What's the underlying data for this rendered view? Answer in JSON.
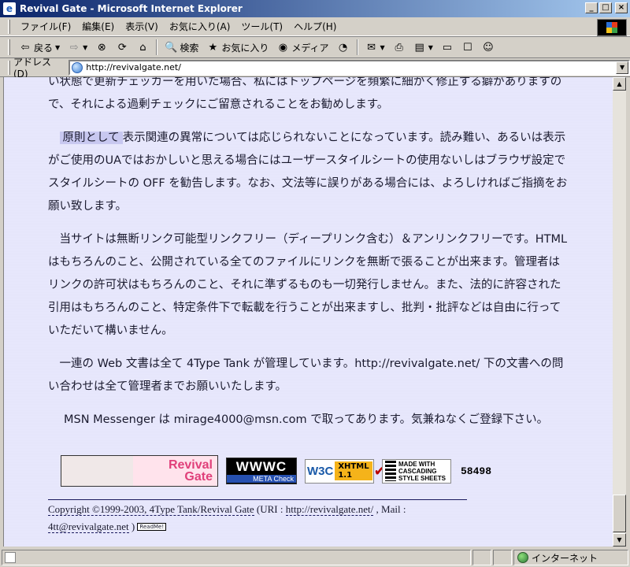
{
  "window": {
    "title": "Revival Gate - Microsoft Internet Explorer",
    "icon": "ie-icon"
  },
  "menu": [
    "ファイル(F)",
    "編集(E)",
    "表示(V)",
    "お気に入り(A)",
    "ツール(T)",
    "ヘルプ(H)"
  ],
  "toolbar": {
    "back": "戻る",
    "search": "検索",
    "favorites": "お気に入り",
    "media": "メディア"
  },
  "address": {
    "label": "アドレス(D)",
    "url": "http://revivalgate.net/"
  },
  "content": {
    "para0": "い状態で更新チェッカーを用いた場合、私にはトップページを頻繁に細かく修正する癖がありますので、それによる過剰チェックにご留意されることをお勧めします。",
    "para1_highlight": "原則として",
    "para1": "表示関連の異常については応じられないことになっています。読み難い、あるいは表示がご使用のUAではおかしいと思える場合にはユーザースタイルシートの使用ないしはブラウザ設定でスタイルシートの OFF を勧告します。なお、文法等に誤りがある場合には、よろしければご指摘をお願い致します。",
    "para2": "当サイトは無断リンク可能型リンクフリー（ディープリンク含む）＆アンリンクフリーです。HTML はもちろんのこと、公開されている全てのファイルにリンクを無断で張ることが出来ます。管理者はリンクの許可状はもちろんのこと、それに準ずるものも一切発行しません。また、法的に許容された引用はもちろんのこと、特定条件下で転載を行うことが出来ますし、批判・批評などは自由に行っていただいて構いません。",
    "para3": "一連の Web 文書は全て 4Type Tank が管理しています。http://revivalgate.net/ 下の文書への問い合わせは全て管理者までお願いいたします。",
    "msn": "MSN Messenger は mirage4000@msn.com で取ってあります。気兼ねなくご登録下さい。"
  },
  "banners": {
    "revival_line1": "Revival",
    "revival_line2": "Gate",
    "www_big": "WWWC",
    "www_small": "META Check",
    "w3c_logo": "W3C",
    "w3c_line1": "XHTML",
    "w3c_line2": "1.1",
    "css_line1": "MADE WITH",
    "css_line2": "CASCADING",
    "css_line3": "STYLE SHEETS",
    "counter": "58498"
  },
  "footer": {
    "copyright": "Copyright ©1999-2003, 4Type Tank/Revival Gate",
    "uri_prefix": " (URI : ",
    "uri": "http://revivalgate.net/",
    "mail_prefix": " , Mail :",
    "mail": "4tt@revivalgate.net",
    "mail_suffix": " )",
    "readme": "ReadMe!"
  },
  "status": {
    "zone": "インターネット"
  }
}
